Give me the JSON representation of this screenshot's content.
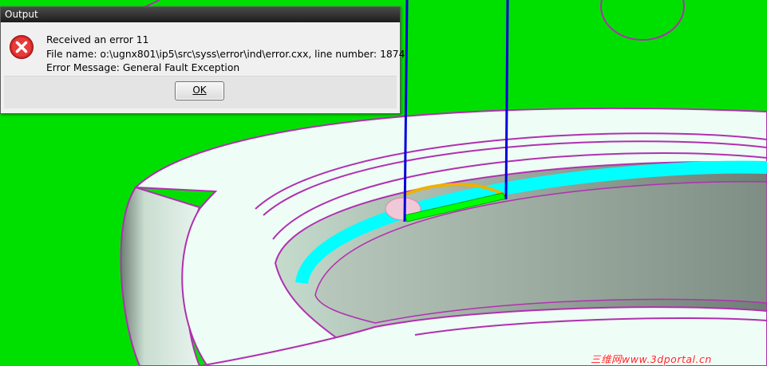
{
  "dialog": {
    "title": "Output",
    "icon": "error-icon",
    "line1": "Received an error 11",
    "line2": "File name: o:\\ugnx801\\ip5\\src\\syss\\error\\ind\\error.cxx, line number: 1874",
    "line3": "Error Message: General Fault Exception",
    "ok_label": "OK"
  },
  "watermark": "三维网www.3dportal.cn",
  "colors": {
    "background_green": "#00e000",
    "part_face": "#eefdf5",
    "edge_magenta": "#b030b0",
    "toolpath_cyan": "#00ffff",
    "tool_axis_blue": "#0000dd"
  }
}
